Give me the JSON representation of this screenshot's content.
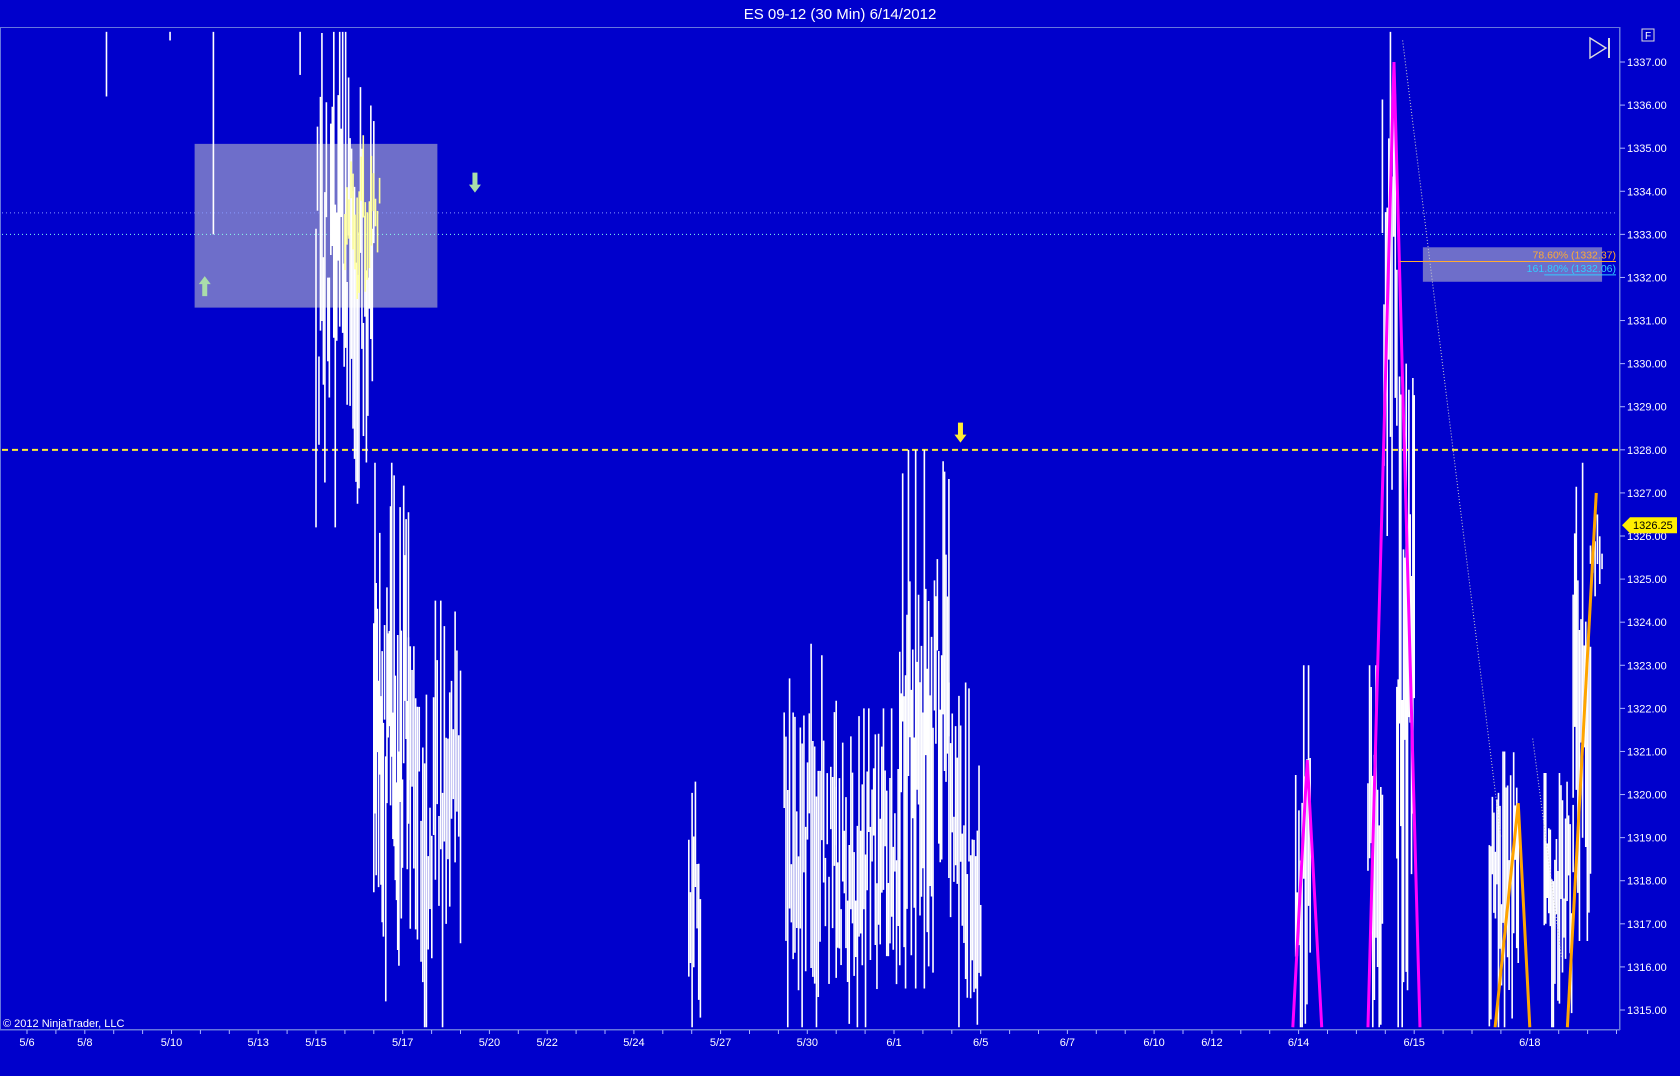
{
  "window": {
    "title": "ES 09-12 (30 Min)  6/14/2012",
    "copyright": "© 2012 NinjaTrader, LLC",
    "f_button_label": "F",
    "colors": {
      "background": "#0000CC",
      "price_bars": "#FFFFFF",
      "tinted_bars": "#FFFF99",
      "highlight_box": "#C8C8C8",
      "dashed_level": "#FFEE33",
      "swing_magenta": "#FF00FF",
      "swing_orange": "#FFA500",
      "fib_786": "#FFAA33",
      "fib_1618": "#33CCFF",
      "last_price_tag": "#FFEE00",
      "arrow_up": "#AADDAA",
      "arrow_down_green": "#AADDAA",
      "arrow_down_yellow": "#FFEE33"
    }
  },
  "chart_data": {
    "type": "bar",
    "instrument": "ES 09-12",
    "interval": "30 Min",
    "date": "6/14/2012",
    "ylim": [
      1314.6,
      1337.7
    ],
    "y_ticks": [
      "1337.00",
      "1336.00",
      "1335.00",
      "1334.00",
      "1333.00",
      "1332.00",
      "1331.00",
      "1330.00",
      "1329.00",
      "1328.00",
      "1327.00",
      "1326.00",
      "1325.00",
      "1324.00",
      "1323.00",
      "1322.00",
      "1321.00",
      "1320.00",
      "1319.00",
      "1318.00",
      "1317.00",
      "1316.00",
      "1315.00"
    ],
    "x_ticks": [
      "5/6",
      "5/8",
      "5/10",
      "5/13",
      "5/15",
      "5/17",
      "5/20",
      "5/22",
      "5/24",
      "5/27",
      "5/30",
      "6/1",
      "6/5",
      "6/7",
      "6/10",
      "6/12",
      "6/14",
      "6/15",
      "6/18"
    ],
    "last_price": "1326.25",
    "horizontal_levels": [
      {
        "price": 1328.0,
        "style": "dashed",
        "color": "#FFEE33"
      },
      {
        "price": 1333.5,
        "style": "dotted",
        "color": "#8899FF"
      },
      {
        "price": 1333.0,
        "style": "dotted",
        "color": "#88FFEE"
      }
    ],
    "fib_levels": [
      {
        "label": "78.60% (1332.37)",
        "price": 1332.37,
        "color": "#FFAA33"
      },
      {
        "label": "161.80% (1332.06)",
        "price": 1332.06,
        "color": "#33CCFF"
      }
    ],
    "highlight_zones": [
      {
        "from_x": 5.8,
        "to_x": 14.2,
        "y_low": 1331.3,
        "y_high": 1335.1
      },
      {
        "from_x": 48.3,
        "to_x": 54.5,
        "y_low": 1331.9,
        "y_high": 1332.7
      }
    ],
    "bar_clusters": [
      {
        "x_from": 2.7,
        "x_to": 2.8,
        "low": 1336.2,
        "high": 1337.7,
        "bars": 1
      },
      {
        "x_from": 4.9,
        "x_to": 5.0,
        "low": 1337.5,
        "high": 1337.7,
        "bars": 1
      },
      {
        "x_from": 6.4,
        "x_to": 6.5,
        "low": 1333.0,
        "high": 1337.7,
        "bars": 1
      },
      {
        "x_from": 9.4,
        "x_to": 9.5,
        "low": 1336.7,
        "high": 1337.7,
        "bars": 1
      },
      {
        "x_from": 10.0,
        "x_to": 12.0,
        "low": 1326.2,
        "high": 1337.7,
        "bars": 40
      },
      {
        "x_from": 12.0,
        "x_to": 13.2,
        "low": 1315.2,
        "high": 1327.7,
        "bars": 30
      },
      {
        "x_from": 13.2,
        "x_to": 15.0,
        "low": 1314.6,
        "high": 1324.5,
        "bars": 30
      },
      {
        "x_from": 22.9,
        "x_to": 23.3,
        "low": 1314.6,
        "high": 1320.3,
        "bars": 8
      },
      {
        "x_from": 26.2,
        "x_to": 28.0,
        "low": 1314.6,
        "high": 1323.5,
        "bars": 30
      },
      {
        "x_from": 28.0,
        "x_to": 30.2,
        "low": 1314.6,
        "high": 1322.0,
        "bars": 40
      },
      {
        "x_from": 30.2,
        "x_to": 31.9,
        "low": 1315.5,
        "high": 1328.0,
        "bars": 35
      },
      {
        "x_from": 31.9,
        "x_to": 33.0,
        "low": 1314.6,
        "high": 1322.6,
        "bars": 20
      },
      {
        "x_from": 43.9,
        "x_to": 44.4,
        "low": 1314.6,
        "high": 1323.0,
        "bars": 10
      },
      {
        "x_from": 46.4,
        "x_to": 46.9,
        "low": 1314.6,
        "high": 1323.0,
        "bars": 10
      },
      {
        "x_from": 46.9,
        "x_to": 47.4,
        "low": 1326.0,
        "high": 1337.7,
        "bars": 10
      },
      {
        "x_from": 47.4,
        "x_to": 48.0,
        "low": 1314.6,
        "high": 1330.0,
        "bars": 14
      },
      {
        "x_from": 50.6,
        "x_to": 51.6,
        "low": 1314.6,
        "high": 1321.0,
        "bars": 20
      },
      {
        "x_from": 52.5,
        "x_to": 53.5,
        "low": 1314.6,
        "high": 1320.5,
        "bars": 20
      },
      {
        "x_from": 53.5,
        "x_to": 54.1,
        "low": 1316.6,
        "high": 1327.7,
        "bars": 12
      },
      {
        "x_from": 54.1,
        "x_to": 54.5,
        "low": 1324.6,
        "high": 1326.5,
        "bars": 6
      }
    ],
    "tinted_clusters": [
      {
        "x_from": 11.0,
        "x_to": 12.2,
        "low": 1331.5,
        "high": 1335.3,
        "bars": 18
      }
    ],
    "swing_lines": [
      {
        "color": "#FF00FF",
        "points": [
          [
            43.8,
            1314.6
          ],
          [
            44.3,
            1320.8
          ],
          [
            44.8,
            1314.6
          ]
        ]
      },
      {
        "color": "#FF00FF",
        "points": [
          [
            46.4,
            1314.6
          ],
          [
            47.3,
            1337.0
          ],
          [
            48.2,
            1314.6
          ]
        ]
      },
      {
        "color": "#FFA500",
        "points": [
          [
            50.8,
            1314.6
          ],
          [
            51.6,
            1319.8
          ],
          [
            52.0,
            1314.6
          ]
        ]
      },
      {
        "color": "#FFA500",
        "points": [
          [
            53.3,
            1314.6
          ],
          [
            54.3,
            1327.0
          ]
        ]
      }
    ],
    "trend_lines": [
      {
        "color": "#CCCCCC",
        "points": [
          [
            47.6,
            1337.5
          ],
          [
            51.0,
            1319.0
          ]
        ]
      },
      {
        "color": "#CCCCCC",
        "points": [
          [
            52.1,
            1321.3
          ],
          [
            53.1,
            1316.2
          ]
        ]
      }
    ],
    "signal_arrows": [
      {
        "direction": "up",
        "x": 6.15,
        "price": 1331.8,
        "color": "#AADDAA"
      },
      {
        "direction": "down",
        "x": 15.5,
        "price": 1334.2,
        "color": "#AADDAA"
      },
      {
        "direction": "down",
        "x": 32.3,
        "price": 1328.4,
        "color": "#FFEE33"
      }
    ]
  }
}
